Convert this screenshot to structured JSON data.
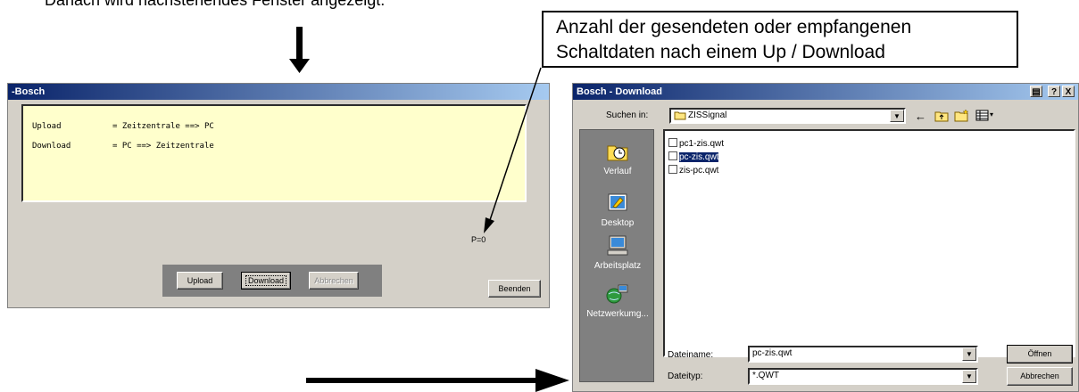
{
  "caption_top": "Danach wird nachstehendes Fenster angezeigt.",
  "annotation": {
    "line1": "Anzahl der gesendeten oder empfangenen",
    "line2": "Schaltdaten nach einem Up / Download"
  },
  "bosch_window": {
    "title": "-Bosch",
    "info_rows": [
      {
        "key": "Upload",
        "value": "= Zeitzentrale ==> PC"
      },
      {
        "key": "Download",
        "value": "= PC ==> Zeitzentrale"
      }
    ],
    "counter": "P=0",
    "buttons": {
      "upload": "Upload",
      "download": "Download",
      "cancel": "Abbrechen",
      "exit": "Beenden"
    }
  },
  "download_dialog": {
    "title": "Bosch - Download",
    "look_in_label": "Suchen in:",
    "look_in_value": "ZISSignal",
    "places": [
      "Verlauf",
      "Desktop",
      "Arbeitsplatz",
      "Netzwerkumg..."
    ],
    "files": [
      "pc1-zis.qwt",
      "pc-zis.qwt",
      "zis-pc.qwt"
    ],
    "selected_file_index": 1,
    "filename_label": "Dateiname:",
    "filename_value": "pc-zis.qwt",
    "filetype_label": "Dateityp:",
    "filetype_value": "*.QWT",
    "open_button": "Öffnen",
    "cancel_button": "Abbrechen",
    "help_icon": "?",
    "close_icon": "X"
  },
  "colors": {
    "titlebar_start": "#0a246a",
    "titlebar_end": "#a6caf0",
    "info_panel": "#ffffcc",
    "window_face": "#d4d0c8",
    "places_bar": "#808080",
    "selection": "#0a246a"
  }
}
